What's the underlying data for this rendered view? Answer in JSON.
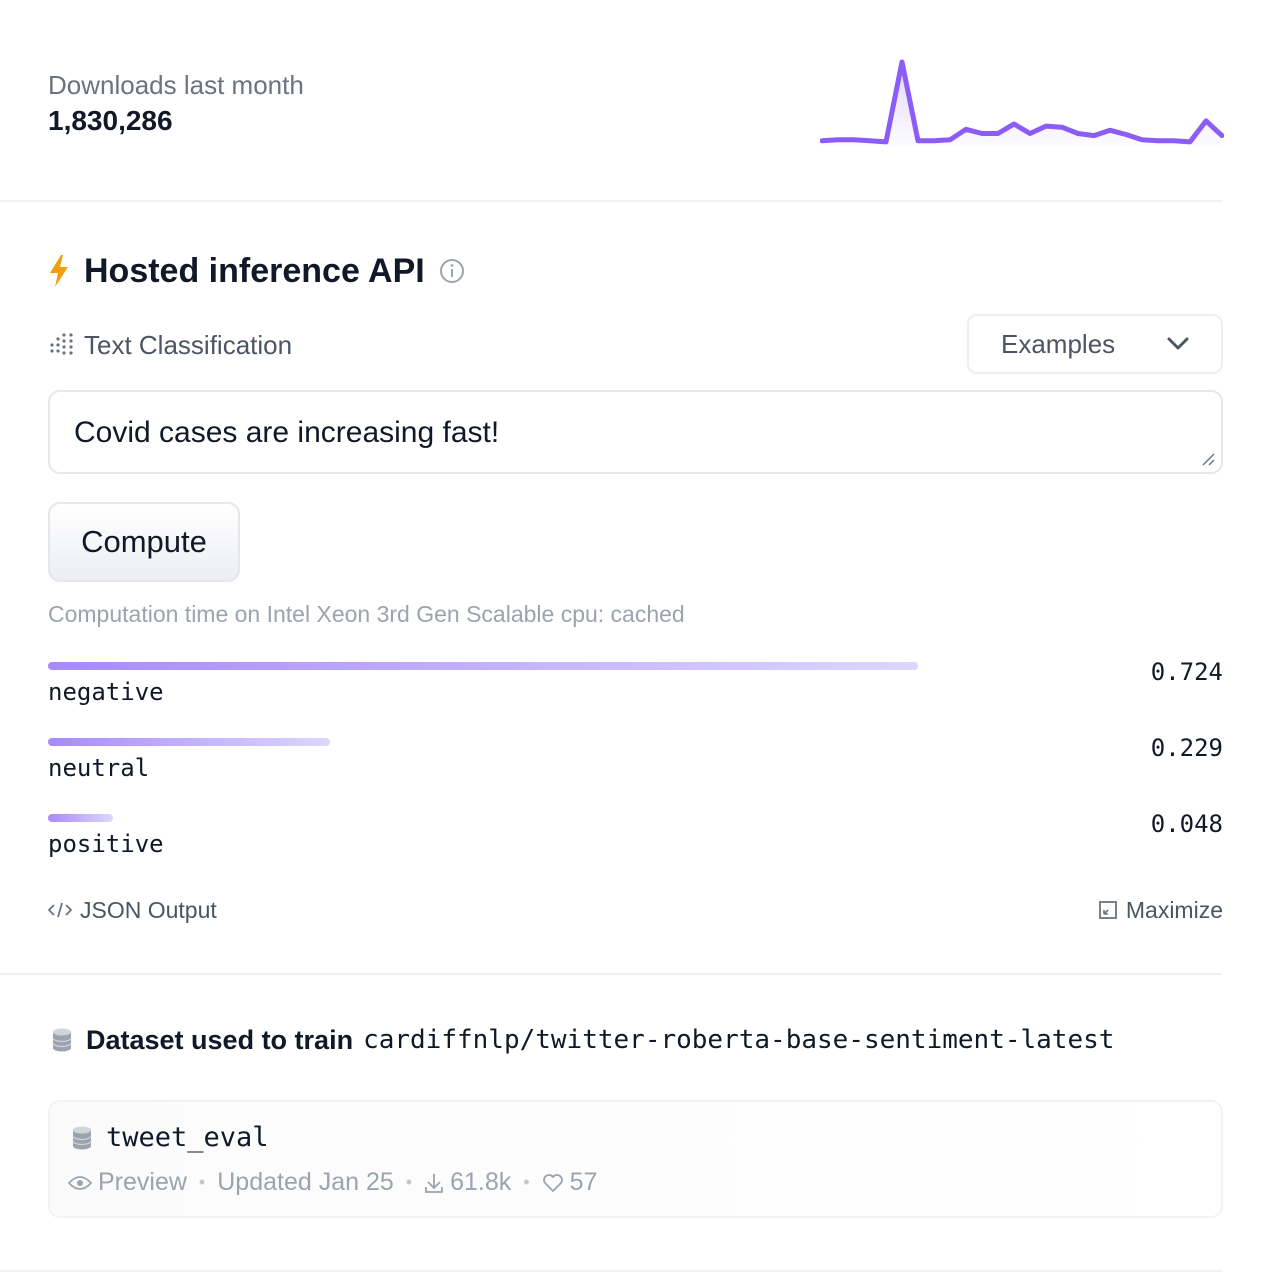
{
  "downloads": {
    "label": "Downloads last month",
    "count": "1,830,286",
    "sparkline": [
      3,
      4,
      4,
      3,
      2,
      78,
      3,
      3,
      4,
      14,
      10,
      10,
      19,
      10,
      17,
      16,
      10,
      8,
      13,
      9,
      4,
      3,
      3,
      2,
      22,
      8
    ]
  },
  "inference": {
    "title": "Hosted inference API",
    "task_label": "Text Classification",
    "examples_label": "Examples",
    "input_value": "Covid cases are increasing fast!",
    "compute_label": "Compute",
    "computation_time": "Computation time on Intel Xeon 3rd Gen Scalable cpu: cached",
    "results": [
      {
        "label": "negative",
        "score": "0.724",
        "value": 0.724
      },
      {
        "label": "neutral",
        "score": "0.229",
        "value": 0.229
      },
      {
        "label": "positive",
        "score": "0.048",
        "value": 0.048
      }
    ],
    "json_output_label": "JSON Output",
    "maximize_label": "Maximize"
  },
  "dataset": {
    "title": "Dataset used to train",
    "model": "cardiffnlp/twitter-roberta-base-sentiment-latest",
    "card": {
      "name": "tweet_eval",
      "preview_label": "Preview",
      "updated": "Updated Jan 25",
      "downloads": "61.8k",
      "likes": "57"
    }
  },
  "colors": {
    "accent": "#8b5cf6",
    "bolt": "#f59e0b"
  }
}
